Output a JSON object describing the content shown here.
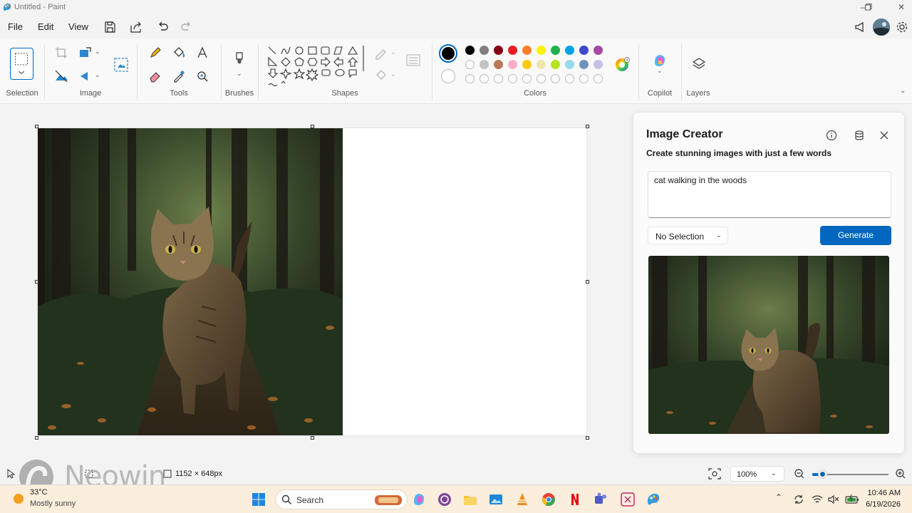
{
  "window": {
    "title": "Untitled - Paint"
  },
  "menu": {
    "file": "File",
    "edit": "Edit",
    "view": "View"
  },
  "ribbon": {
    "groups": {
      "selection": "Selection",
      "image": "Image",
      "tools": "Tools",
      "brushes": "Brushes",
      "shapes": "Shapes",
      "colors": "Colors",
      "copilot": "Copilot",
      "layers": "Layers"
    },
    "palette_row1": [
      "#000000",
      "#7f7f7f",
      "#880015",
      "#ed1c24",
      "#ff7f27",
      "#fff200",
      "#22b14c",
      "#00a2e8",
      "#3f48cc",
      "#a349a4"
    ],
    "palette_row2": [
      "#ffffff",
      "#c3c3c3",
      "#b97a57",
      "#ffaec9",
      "#ffc90e",
      "#efe4b0",
      "#b5e61d",
      "#99d9ea",
      "#7092be",
      "#c8bfe7"
    ],
    "primary_color": "#000000",
    "secondary_color": "#ffffff"
  },
  "image_creator": {
    "title": "Image Creator",
    "subtitle": "Create stunning images with just a few words",
    "prompt": "cat walking in the woods",
    "style": "No Selection",
    "generate": "Generate"
  },
  "status": {
    "canvas_size": "1152 × 648px",
    "zoom": "100%"
  },
  "watermark": "Neowin",
  "taskbar": {
    "weather_temp": "33°C",
    "weather_desc": "Mostly sunny",
    "search": "Search",
    "time": "10:46 AM",
    "date": "6/19/2026"
  },
  "colors": {
    "accent": "#0067c0",
    "taskbar": "#fbeedd"
  }
}
